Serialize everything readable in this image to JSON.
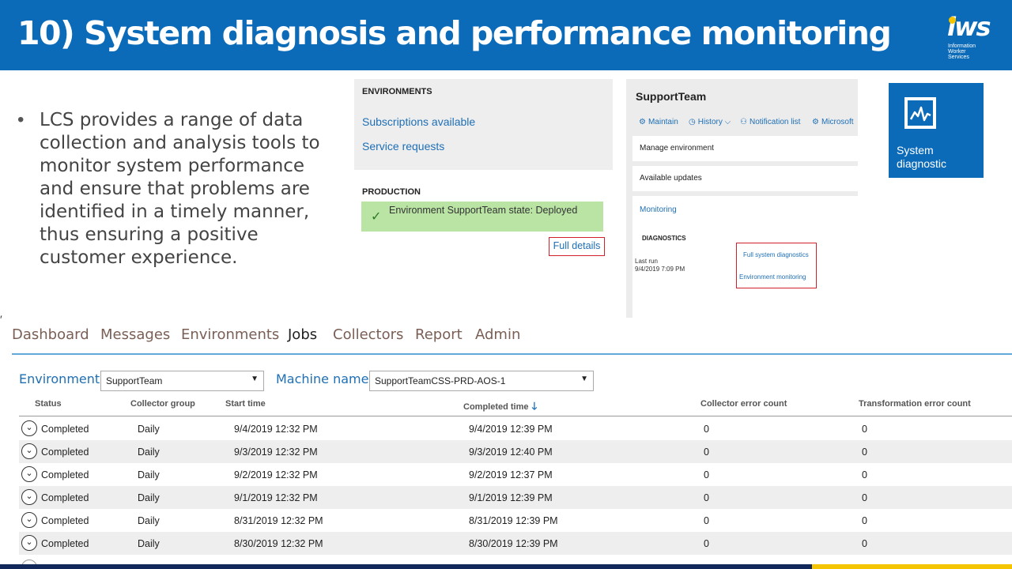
{
  "slide": {
    "title": "10) System diagnosis and performance monitoring",
    "bullet": "LCS provides a range of data collection and analysis tools to monitor system performance and ensure that problems are identified in a timely manner, thus ensuring a positive customer experience.",
    "colors": {
      "primary": "#0b6bb8",
      "accent": "#f4c400",
      "footer": "#12285a"
    }
  },
  "logo": {
    "mark": "iws",
    "line1": "Information",
    "line2": "Worker",
    "line3": "Services"
  },
  "environments_panel": {
    "heading": "ENVIRONMENTS",
    "links": [
      "Subscriptions available",
      "Service requests"
    ],
    "production_heading": "PRODUCTION",
    "status_text": "Environment SupportTeam state: Deployed",
    "full_details": "Full details"
  },
  "supportteam_panel": {
    "title": "SupportTeam",
    "toolbar": [
      "Maintain",
      "History",
      "Notification list",
      "Microsoft"
    ],
    "manage_environment": "Manage environment",
    "available_updates": "Available updates",
    "monitoring": "Monitoring",
    "diagnostics_heading": "DIAGNOSTICS",
    "full_system_diagnostics": "Full system diagnostics",
    "environment_monitoring": "Environment monitoring",
    "last_run_label": "Last run",
    "last_run_value": "9/4/2019 7:09 PM"
  },
  "tile": {
    "label": "System diagnostic",
    "icon": "monitor-chart-icon"
  },
  "nav": {
    "items": [
      "Dashboard",
      "Messages",
      "Environments",
      "Jobs",
      "Collectors",
      "Report",
      "Admin"
    ],
    "active": "Jobs"
  },
  "filters": {
    "environment_label": "Environment",
    "environment_value": "SupportTeam",
    "machine_label": "Machine name",
    "machine_value": "SupportTeamCSS-PRD-AOS-1"
  },
  "table": {
    "headers": [
      "Status",
      "Collector group",
      "Start time",
      "Completed time",
      "Collector error count",
      "Transformation error count"
    ],
    "sorted_column": "Completed time",
    "rows": [
      [
        "Completed",
        "Daily",
        "9/4/2019 12:32 PM",
        "9/4/2019 12:39 PM",
        "0",
        "0"
      ],
      [
        "Completed",
        "Daily",
        "9/3/2019 12:32 PM",
        "9/3/2019 12:40 PM",
        "0",
        "0"
      ],
      [
        "Completed",
        "Daily",
        "9/2/2019 12:32 PM",
        "9/2/2019 12:37 PM",
        "0",
        "0"
      ],
      [
        "Completed",
        "Daily",
        "9/1/2019 12:32 PM",
        "9/1/2019 12:39 PM",
        "0",
        "0"
      ],
      [
        "Completed",
        "Daily",
        "8/31/2019 12:32 PM",
        "8/31/2019 12:39 PM",
        "0",
        "0"
      ],
      [
        "Completed",
        "Daily",
        "8/30/2019 12:32 PM",
        "8/30/2019 12:39 PM",
        "0",
        "0"
      ]
    ]
  }
}
